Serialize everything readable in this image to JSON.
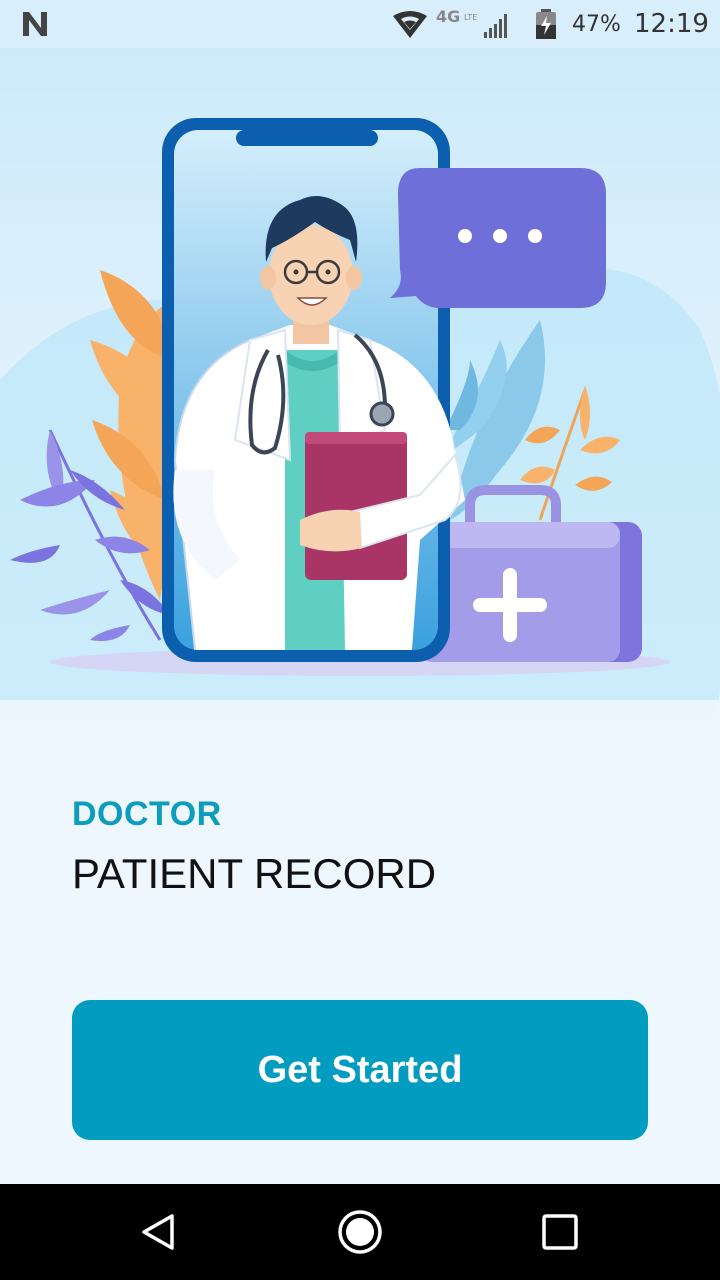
{
  "status_bar": {
    "battery": "47%",
    "time": "12:19",
    "network": "4G LTE",
    "icons": [
      "n-icon",
      "wifi-icon",
      "lte-signal-icon",
      "battery-icon"
    ]
  },
  "illustration": {
    "subject": "doctor-in-phone-illustration",
    "colors": {
      "phone_frame": "#0b5fae",
      "bubble": "#6f6fd9",
      "kit": "#9a93e4",
      "clipboard": "#a93566",
      "leaf_orange": "#f6ae5c",
      "leaf_purple": "#7b73e0",
      "leaf_blue": "#7fc3e6"
    }
  },
  "heading": {
    "label": "DOCTOR",
    "title": "PATIENT RECORD"
  },
  "cta": {
    "label": "Get Started",
    "color": "#019cbf"
  },
  "nav": {
    "icons": [
      "back-icon",
      "home-icon",
      "recents-icon"
    ]
  }
}
